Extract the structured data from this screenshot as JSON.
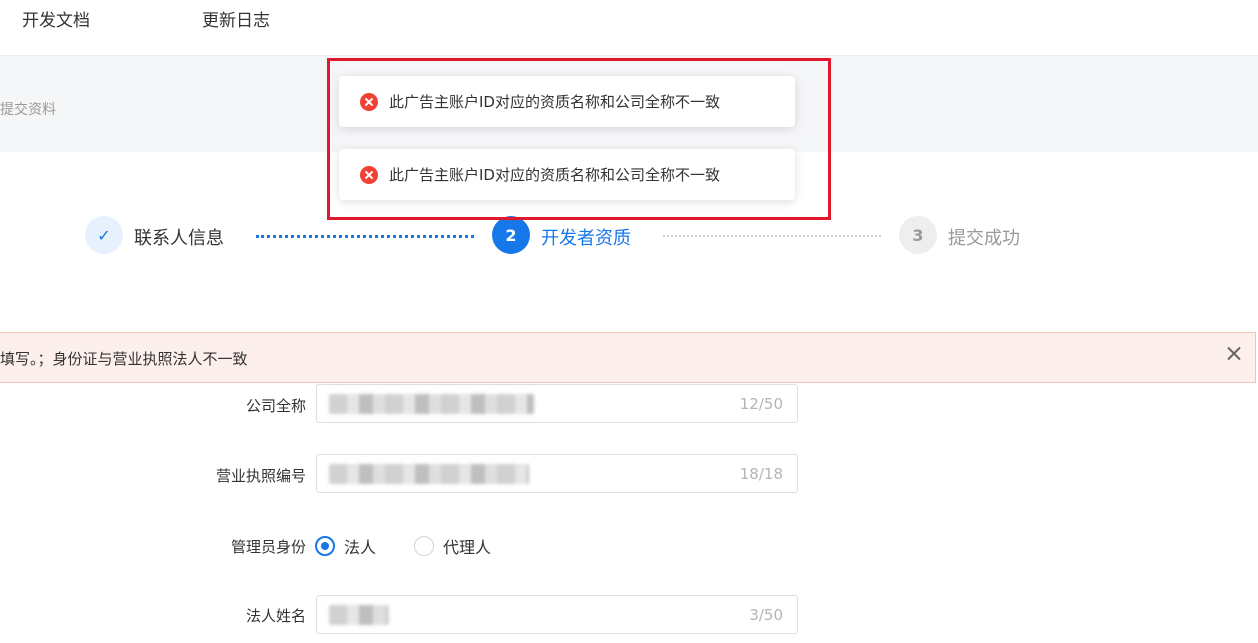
{
  "nav": {
    "items": [
      "开发文档",
      "更新日志"
    ]
  },
  "breadcrumb": "提交资料",
  "steps": [
    {
      "marker": "✓",
      "label": "联系人信息",
      "state": "done"
    },
    {
      "marker": "2",
      "label": "开发者资质",
      "state": "active"
    },
    {
      "marker": "3",
      "label": "提交成功",
      "state": "pending"
    }
  ],
  "alert": {
    "message": "填写。；身份证与营业执照法人不一致"
  },
  "toasts": [
    {
      "text": "此广告主账户ID对应的资质名称和公司全称不一致"
    },
    {
      "text": "此广告主账户ID对应的资质名称和公司全称不一致"
    }
  ],
  "form": {
    "company_name": {
      "label": "公司全称",
      "count": "12/50"
    },
    "license_no": {
      "label": "营业执照编号",
      "count": "18/18"
    },
    "admin_identity": {
      "label": "管理员身份",
      "options": [
        "法人",
        "代理人"
      ],
      "selected": "法人"
    },
    "legal_name": {
      "label": "法人姓名",
      "count": "3/50"
    }
  },
  "colors": {
    "primary": "#1677e8",
    "error": "#f04134",
    "highlight_border": "#e0192c",
    "alert_bg": "#fdefec"
  }
}
